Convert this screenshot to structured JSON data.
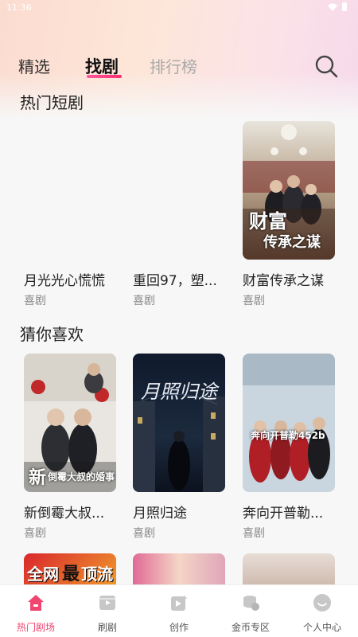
{
  "status_bar": {
    "time": "11:36"
  },
  "top_tabs": [
    {
      "label": "精选"
    },
    {
      "label": "找剧"
    },
    {
      "label": "排行榜"
    }
  ],
  "sections": {
    "hot": {
      "title": "热门短剧",
      "items": [
        {
          "title": "月光光心慌慌",
          "genre": "喜剧"
        },
        {
          "title": "重回97，塑...",
          "genre": "喜剧"
        },
        {
          "title": "财富传承之谋",
          "genre": "喜剧",
          "poster_text": [
            "财富",
            "传承之谋"
          ]
        }
      ]
    },
    "guess": {
      "title": "猜你喜欢",
      "items": [
        {
          "title": "新倒霉大叔...",
          "genre": "喜剧",
          "poster_text": [
            "新",
            "倒霉大叔的婚事"
          ]
        },
        {
          "title": "月照归途",
          "genre": "喜剧",
          "poster_text": [
            "月照归途"
          ]
        },
        {
          "title": "奔向开普勒...",
          "genre": "喜剧",
          "poster_text": [
            "奔向开普勒452b"
          ]
        }
      ]
    },
    "more": {
      "items": [
        {
          "poster_text": [
            "全网",
            "最",
            "顶流"
          ]
        },
        {
          "poster_text": []
        },
        {
          "poster_text": []
        }
      ]
    }
  },
  "bottom_nav": [
    {
      "label": "热门剧场",
      "icon": "home-icon",
      "active": true
    },
    {
      "label": "刷剧",
      "icon": "film-icon",
      "active": false
    },
    {
      "label": "创作",
      "icon": "create-icon",
      "active": false
    },
    {
      "label": "金币专区",
      "icon": "coin-icon",
      "active": false
    },
    {
      "label": "个人中心",
      "icon": "profile-icon",
      "active": false
    }
  ],
  "colors": {
    "accent": "#f0456e",
    "tab_underline": "#ff3d7f"
  }
}
